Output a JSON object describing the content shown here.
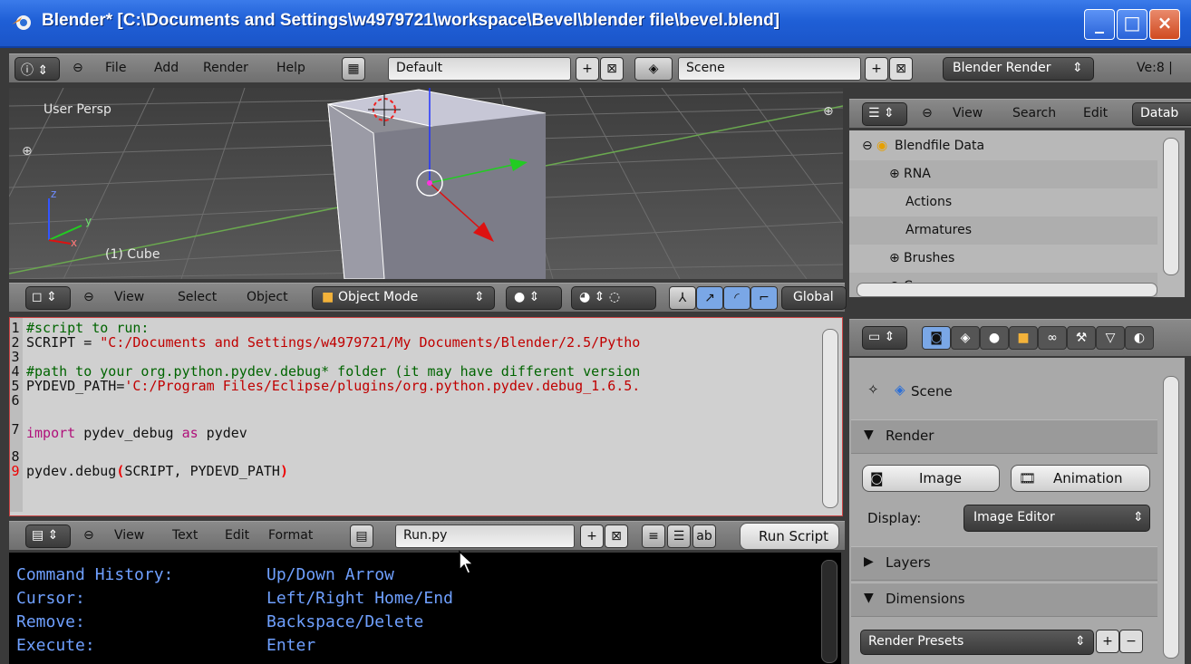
{
  "window": {
    "title": "Blender* [C:\\Documents and Settings\\w4979721\\workspace\\Bevel\\blender file\\bevel.blend]",
    "minimize_glyph": "_",
    "maximize_glyph": "□",
    "close_glyph": "×"
  },
  "info_header": {
    "menus": [
      "File",
      "Add",
      "Render",
      "Help"
    ],
    "layout": "Default",
    "scene": "Scene",
    "engine": "Blender Render",
    "stats": "Ve:8 |"
  },
  "viewport": {
    "view_label": "User Persp",
    "object_label": "(1) Cube",
    "axis_z": "z",
    "axis_y": "y",
    "axis_x": "x"
  },
  "view3d_header": {
    "menus": [
      "View",
      "Select",
      "Object"
    ],
    "mode": "Object Mode",
    "orientation": "Global"
  },
  "outliner": {
    "menus": [
      "View",
      "Search",
      "Edit"
    ],
    "display_mode": "Datab",
    "items": [
      {
        "label": "Blendfile Data"
      },
      {
        "label": "RNA"
      },
      {
        "label": "Actions"
      },
      {
        "label": "Armatures"
      },
      {
        "label": "Brushes"
      },
      {
        "label": "Cameras"
      }
    ]
  },
  "text_editor": {
    "line_numbers": [
      "1",
      "2",
      "3",
      "4",
      "5",
      "6",
      "7",
      "8",
      "9"
    ],
    "lines": {
      "l1": "#script to run:",
      "l2a": "SCRIPT = ",
      "l2b": "\"C:/Documents and Settings/w4979721/My Documents/Blender/2.5/Pytho",
      "l4": "#path to your org.python.pydev.debug* folder (it may have different version",
      "l5a": "PYDEVD_PATH=",
      "l5b": "'C:/Program Files/Eclipse/plugins/org.python.pydev.debug_1.6.5.",
      "l7a": "import",
      "l7b": " pydev_debug ",
      "l7c": "as",
      "l7d": " pydev",
      "l9a": "pydev.debug",
      "l9b": "(",
      "l9c": "SCRIPT, PYDEVD_PATH",
      "l9d": ")"
    },
    "menus": [
      "View",
      "Text",
      "Edit",
      "Format"
    ],
    "filename": "Run.py",
    "run_button": "Run Script"
  },
  "console": {
    "rows": [
      {
        "key": "Command History:",
        "value": "Up/Down Arrow"
      },
      {
        "key": "Cursor:",
        "value": "Left/Right Home/End"
      },
      {
        "key": "Remove:",
        "value": "Backspace/Delete"
      },
      {
        "key": "Execute:",
        "value": "Enter"
      }
    ]
  },
  "properties": {
    "context": "Scene",
    "render_panel": "Render",
    "image_button": "Image",
    "animation_button": "Animation",
    "display_label": "Display:",
    "display_value": "Image Editor",
    "layers_panel": "Layers",
    "dimensions_panel": "Dimensions",
    "render_presets": "Render Presets"
  },
  "colors": {
    "accent_red": "#c00000",
    "comment_green": "#006400",
    "keyword_magenta": "#b0107a",
    "console_blue": "#6fa0ff"
  }
}
